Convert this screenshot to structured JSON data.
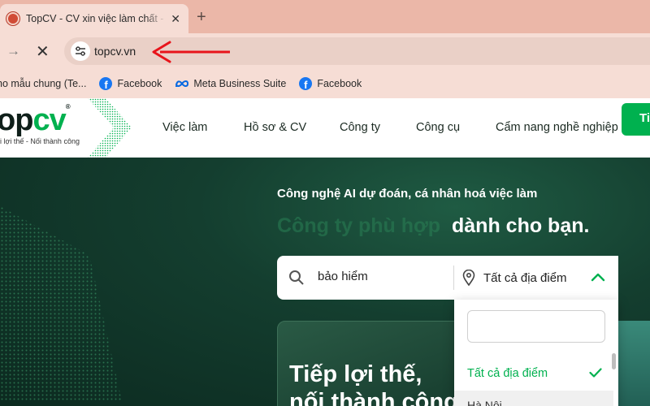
{
  "browser": {
    "tab": {
      "title": "TopCV - CV xin việc làm chất - T",
      "close": "✕"
    },
    "new_tab": "+",
    "forward": "→",
    "stop": "✕",
    "url": "topcv.vn"
  },
  "bookmarks": [
    {
      "label": "ho mẫu chung (Te..."
    },
    {
      "label": "Facebook",
      "icon": "facebook-icon"
    },
    {
      "label": "Meta Business Suite",
      "icon": "meta-icon"
    },
    {
      "label": "Facebook",
      "icon": "facebook-icon"
    }
  ],
  "site": {
    "logo_a": "op",
    "logo_b": "cv",
    "logo_mark": "®",
    "slogan": "i lợi thế - Nối thành công",
    "nav": [
      "Việc làm",
      "Hồ sơ & CV",
      "Công ty",
      "Công cụ",
      "Cẩm nang nghề nghiệp"
    ]
  },
  "hero": {
    "line1": "Công nghệ AI dự đoán, cá nhân hoá việc làm",
    "ghost": "Công ty phù hợp",
    "line2": "dành cho bạn.",
    "search_value": "bảo hiểm",
    "location_label": "Tất cả địa điểm",
    "find_button": "Ti",
    "card_title_1": "Tiếp lợi thế,",
    "card_title_2": "nối thành công"
  },
  "dropdown": {
    "search_value": "",
    "selected_option": "Tất cả địa điểm",
    "next_option": "Hà Nội"
  },
  "colors": {
    "brand_green": "#00b14f",
    "chrome_tab": "#ebb7a8",
    "arrow_red": "#e8141b"
  }
}
